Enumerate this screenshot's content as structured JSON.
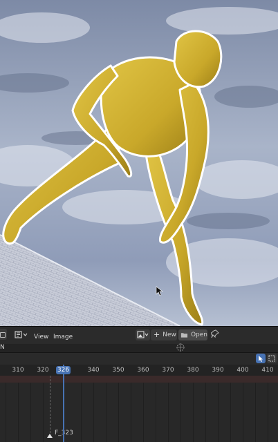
{
  "image_editor": {
    "menus": [
      "View",
      "Image"
    ],
    "new_label": "New",
    "open_label": "Open",
    "sub_header_letter": "N"
  },
  "timeline": {
    "ruler_labels": [
      "310",
      "320",
      "340",
      "350",
      "360",
      "370",
      "380",
      "390",
      "400",
      "410"
    ],
    "current_frame": "326",
    "marker_label": "F_323"
  },
  "icons": [
    "image-editor-type-icon",
    "mode-icon",
    "image-browse-icon",
    "plus-icon",
    "folder-icon",
    "pin-icon",
    "gizmo-icon",
    "select-tool-icon",
    "box-select-icon"
  ],
  "colors": {
    "accent": "#4772b3",
    "figure": "#c9a82a",
    "sky": "#8b9bb8"
  }
}
